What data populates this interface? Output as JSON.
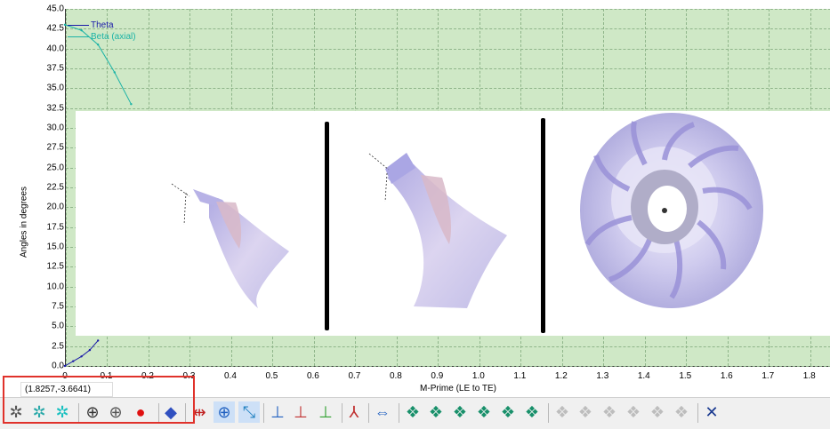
{
  "chart_data": {
    "type": "line",
    "ylabel": "Angles in degrees",
    "xlabel": "M-Prime (LE to TE)",
    "ylim": [
      0.0,
      45.0
    ],
    "xlim": [
      0.0,
      1.85
    ],
    "y_ticks": [
      "0.0",
      "2.5",
      "5.0",
      "7.5",
      "10.0",
      "12.5",
      "15.0",
      "17.5",
      "20.0",
      "22.5",
      "25.0",
      "27.5",
      "30.0",
      "32.5",
      "35.0",
      "37.5",
      "40.0",
      "42.5",
      "45.0"
    ],
    "x_ticks": [
      "0",
      "0.1",
      "0.2",
      "0.3",
      "0.4",
      "0.5",
      "0.6",
      "0.7",
      "0.8",
      "0.9",
      "1.0",
      "1.1",
      "1.2",
      "1.3",
      "1.4",
      "1.5",
      "1.6",
      "1.7",
      "1.8"
    ],
    "grid": true,
    "legend_placement": "top-left",
    "series": [
      {
        "name": "Theta",
        "color": "#1a1aa8",
        "x": [
          0.0,
          0.02,
          0.04,
          0.06,
          0.08
        ],
        "y": [
          0.0,
          0.6,
          1.2,
          2.0,
          3.2
        ]
      },
      {
        "name": "Beta (axial)",
        "color": "#1bb3a6",
        "x": [
          0.0,
          0.04,
          0.08,
          0.12,
          0.16
        ],
        "y": [
          43.0,
          42.3,
          40.5,
          37.0,
          33.0
        ]
      }
    ]
  },
  "status": {
    "coordinates": "(1.8257,-3.6641)"
  },
  "colors": {
    "plot_bg": "#cfe8c6",
    "highlight": "#e0322b",
    "blade_fill": "#c9c6e8"
  },
  "toolbar": {
    "buttons": [
      {
        "name": "view-gray-wheel-icon",
        "glyph": "✲",
        "color": "#555555"
      },
      {
        "name": "view-gray-teal-wheel-icon",
        "glyph": "✲",
        "color": "#2aa9a9"
      },
      {
        "name": "view-teal-wheel-icon",
        "glyph": "✲",
        "color": "#19c0c0"
      },
      {
        "name": "sphere-outline-icon",
        "glyph": "⊕",
        "color": "#333333"
      },
      {
        "name": "sphere-grid-icon",
        "glyph": "⊕",
        "color": "#555555"
      },
      {
        "name": "red-sphere-icon",
        "glyph": "●",
        "color": "#e01010"
      },
      {
        "name": "shaded-cube-icon",
        "glyph": "◆",
        "color": "#3050c0"
      },
      {
        "name": "mirror-blade-icon",
        "glyph": "⇹",
        "color": "#c02020"
      },
      {
        "name": "crosshair-icon",
        "glyph": "⊕",
        "color": "#2060c0"
      },
      {
        "name": "axes-xyz-icon",
        "glyph": "⤡",
        "color": "#2080c0"
      },
      {
        "name": "view-zy-icon",
        "glyph": "⊥",
        "color": "#2060c0"
      },
      {
        "name": "view-xz-icon",
        "glyph": "⊥",
        "color": "#c03030"
      },
      {
        "name": "view-yx-icon",
        "glyph": "⊥",
        "color": "#30a030"
      },
      {
        "name": "isometric-axes-icon",
        "glyph": "⅄",
        "color": "#c03030"
      },
      {
        "name": "pan-arrows-icon",
        "glyph": "⇔",
        "color": "#2060c0"
      },
      {
        "name": "blade-view-1-icon",
        "glyph": "❖",
        "color": "#18906a"
      },
      {
        "name": "blade-view-2-icon",
        "glyph": "❖",
        "color": "#18906a"
      },
      {
        "name": "blade-view-3-icon",
        "glyph": "❖",
        "color": "#18906a"
      },
      {
        "name": "blade-view-4-icon",
        "glyph": "❖",
        "color": "#18906a"
      },
      {
        "name": "blade-view-5-icon",
        "glyph": "❖",
        "color": "#18906a"
      },
      {
        "name": "blade-view-6-icon",
        "glyph": "❖",
        "color": "#18906a"
      },
      {
        "name": "disabled-view-1-icon",
        "glyph": "❖",
        "color": "#bdbdbd"
      },
      {
        "name": "disabled-view-2-icon",
        "glyph": "❖",
        "color": "#bdbdbd"
      },
      {
        "name": "disabled-view-3-icon",
        "glyph": "❖",
        "color": "#bdbdbd"
      },
      {
        "name": "disabled-view-4-icon",
        "glyph": "❖",
        "color": "#bdbdbd"
      },
      {
        "name": "disabled-view-5-icon",
        "glyph": "❖",
        "color": "#bdbdbd"
      },
      {
        "name": "disabled-view-6-icon",
        "glyph": "❖",
        "color": "#bdbdbd"
      },
      {
        "name": "close-view-icon",
        "glyph": "✕",
        "color": "#1a3a90"
      }
    ]
  }
}
